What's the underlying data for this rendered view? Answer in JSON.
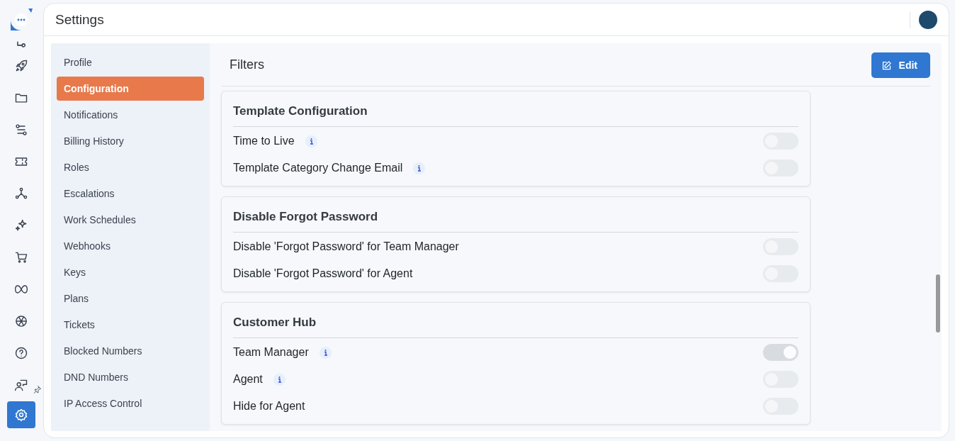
{
  "rail_items": [
    {
      "selected": false
    },
    {
      "selected": false
    },
    {
      "selected": false
    },
    {
      "selected": false
    },
    {
      "selected": false
    },
    {
      "selected": false
    },
    {
      "selected": false
    },
    {
      "selected": false
    },
    {
      "selected": false
    },
    {
      "selected": false
    },
    {
      "selected": false
    },
    {
      "selected": false
    },
    {
      "selected": true
    }
  ],
  "header": {
    "title": "Settings"
  },
  "menu": [
    {
      "label": "Profile",
      "selected": false
    },
    {
      "label": "Configuration",
      "selected": true
    },
    {
      "label": "Notifications",
      "selected": false
    },
    {
      "label": "Billing History",
      "selected": false
    },
    {
      "label": "Roles",
      "selected": false
    },
    {
      "label": "Escalations",
      "selected": false
    },
    {
      "label": "Work Schedules",
      "selected": false
    },
    {
      "label": "Webhooks",
      "selected": false
    },
    {
      "label": "Keys",
      "selected": false
    },
    {
      "label": "Plans",
      "selected": false
    },
    {
      "label": "Tickets",
      "selected": false
    },
    {
      "label": "Blocked Numbers",
      "selected": false
    },
    {
      "label": "DND Numbers",
      "selected": false
    },
    {
      "label": "IP Access Control",
      "selected": false
    }
  ],
  "content": {
    "title": "Filters",
    "edit_button": "Edit"
  },
  "cards": [
    {
      "title": "Template Configuration",
      "rows": [
        {
          "label": "Time to Live",
          "info": true,
          "on": false
        },
        {
          "label": "Template Category Change Email",
          "info": true,
          "on": false
        }
      ]
    },
    {
      "title": "Disable Forgot Password",
      "rows": [
        {
          "label": "Disable 'Forgot Password' for Team Manager",
          "info": false,
          "on": false
        },
        {
          "label": "Disable 'Forgot Password' for Agent",
          "info": false,
          "on": false
        }
      ]
    },
    {
      "title": "Customer Hub",
      "rows": [
        {
          "label": "Team Manager",
          "info": true,
          "on": true
        },
        {
          "label": "Agent",
          "info": true,
          "on": false
        },
        {
          "label": "Hide for Agent",
          "info": false,
          "on": false
        }
      ]
    }
  ]
}
